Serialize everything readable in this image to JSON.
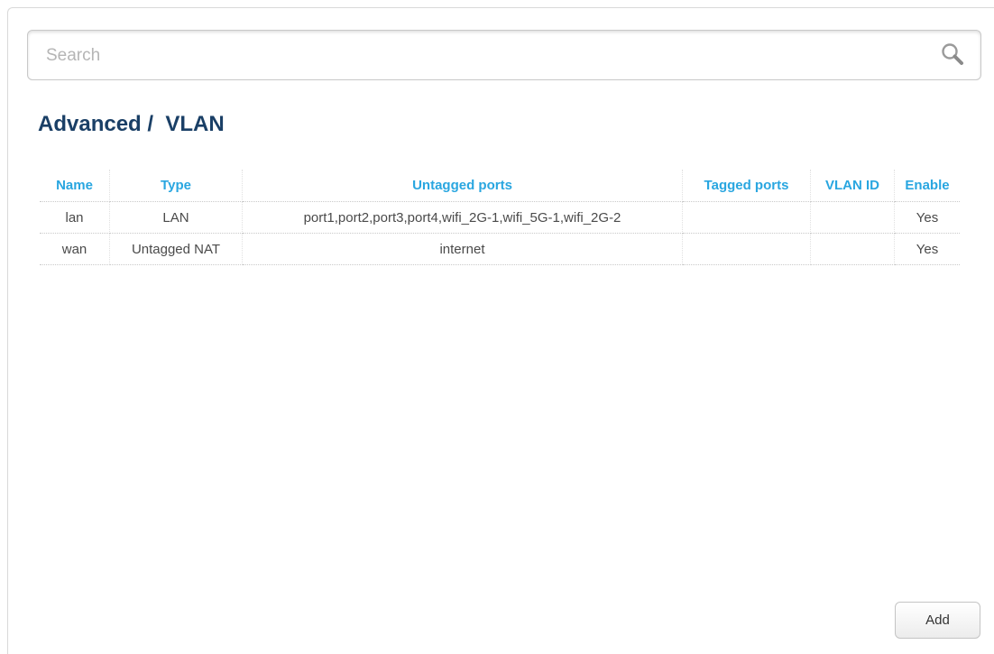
{
  "search": {
    "placeholder": "Search",
    "value": ""
  },
  "page": {
    "title": "Advanced /  VLAN"
  },
  "table": {
    "columns": {
      "name": "Name",
      "type": "Type",
      "untagged_ports": "Untagged ports",
      "tagged_ports": "Tagged ports",
      "vlan_id": "VLAN ID",
      "enable": "Enable"
    },
    "rows": [
      {
        "name": "lan",
        "type": "LAN",
        "untagged_ports": "port1,port2,port3,port4,wifi_2G-1,wifi_5G-1,wifi_2G-2",
        "tagged_ports": "",
        "vlan_id": "",
        "enable": "Yes"
      },
      {
        "name": "wan",
        "type": "Untagged NAT",
        "untagged_ports": "internet",
        "tagged_ports": "",
        "vlan_id": "",
        "enable": "Yes"
      }
    ]
  },
  "actions": {
    "add_label": "Add"
  },
  "colors": {
    "title": "#1a3f66",
    "header": "#29a6e0",
    "cell_text": "#4a4a4a"
  },
  "icons": {
    "search": "search-icon"
  }
}
